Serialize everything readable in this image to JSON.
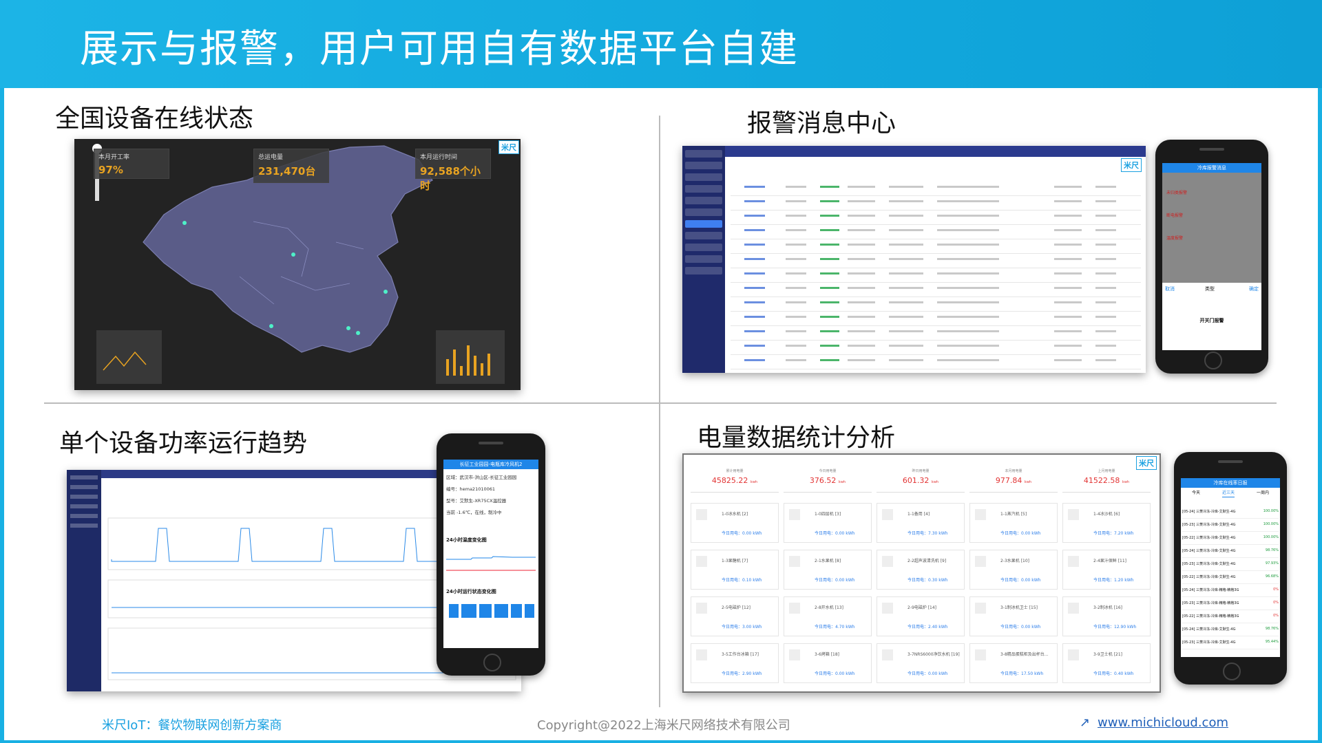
{
  "header": {
    "title": "展示与报警，用户可用自有数据平台自建"
  },
  "sections": {
    "online": "全国设备在线状态",
    "alarm": "报警消息中心",
    "power": "单个设备功率运行趋势",
    "energy": "电量数据统计分析"
  },
  "map_cards": [
    {
      "label": "本月开工率",
      "value": "97%"
    },
    {
      "label": "总运电量",
      "value": "231,470台"
    },
    {
      "label": "本月运行时间",
      "value": "92,588个小时"
    }
  ],
  "logo_text": "米尺",
  "phone_alarm": {
    "title": "冷库报警消息",
    "rows": [
      "未归类报警",
      "断电报警",
      "温度报警",
      "开关门报警"
    ],
    "picker_cancel": "取消",
    "picker_title": "类型",
    "picker_ok": "确定"
  },
  "phone_power": {
    "title": "长征工业园园-电瓶库冷风机2",
    "items": [
      "区域：武汉市-洪山区-长征工业园园",
      "编号：hema21010061",
      "型号：艾默生-XR75CX温控器",
      "当前 -1.6℃，在线，制冷中"
    ],
    "chart1": "24小时温度变化图",
    "chart2": "24小时运行状态变化图"
  },
  "energy": {
    "totals": [
      {
        "label": "累计用电量",
        "value": "45825.22",
        "unit": "kwh"
      },
      {
        "label": "今日用电量",
        "value": "376.52",
        "unit": "kwh"
      },
      {
        "label": "昨日用电量",
        "value": "601.32",
        "unit": "kwh"
      },
      {
        "label": "本月用电量",
        "value": "977.84",
        "unit": "kwh"
      },
      {
        "label": "上月用电量",
        "value": "41522.58",
        "unit": "kwh"
      }
    ],
    "devices": [
      {
        "name": "1-0冰水机 [2]",
        "val": "今日用电：0.00 kWh"
      },
      {
        "name": "1-0四层机 [3]",
        "val": "今日用电：0.00 kWh"
      },
      {
        "name": "1-1备用 [4]",
        "val": "今日用电：7.30 kWh"
      },
      {
        "name": "1-1蒸汽机 [5]",
        "val": "今日用电：0.00 kWh"
      },
      {
        "name": "1-4冰沙机 [6]",
        "val": "今日用电：7.20 kWh"
      },
      {
        "name": "1-3果糖机 [7]",
        "val": "今日用电：0.10 kWh"
      },
      {
        "name": "2-1水果机 [8]",
        "val": "今日用电：0.00 kWh"
      },
      {
        "name": "2-2超声波清洗机 [9]",
        "val": "今日用电：0.30 kWh"
      },
      {
        "name": "2-3水果机 [10]",
        "val": "今日用电：0.00 kWh"
      },
      {
        "name": "2-4果汁保鲜 [11]",
        "val": "今日用电：1.20 kWh"
      },
      {
        "name": "2-5电磁炉 [12]",
        "val": "今日用电：3.00 kWh"
      },
      {
        "name": "2-8开水机 [13]",
        "val": "今日用电：4.70 kWh"
      },
      {
        "name": "2-9电磁炉 [14]",
        "val": "今日用电：2.40 kWh"
      },
      {
        "name": "3-1制冰机卫士 [15]",
        "val": "今日用电：0.00 kWh"
      },
      {
        "name": "3-2制冰机 [16]",
        "val": "今日用电：12.90 kWh"
      },
      {
        "name": "3-5工作台冰箱 [17]",
        "val": "今日用电：2.90 kWh"
      },
      {
        "name": "3-6烤箱 [18]",
        "val": "今日用电：0.00 kWh"
      },
      {
        "name": "3-7NRS6000净饮水机 [19]",
        "val": "今日用电：0.00 kWh"
      },
      {
        "name": "3-8精品蛋糕柜及出杯台... ",
        "val": "今日用电：17.50 kWh"
      },
      {
        "name": "3-9卫士机 [21]",
        "val": "今日用电：0.40 kWh"
      }
    ]
  },
  "phone_energy": {
    "title": "冷库在线率日报",
    "tabs": [
      "今天",
      "近三天",
      "一周内"
    ],
    "rows": [
      {
        "n": "[05-24] 三菱冷冻-冷库-艾默生-4G",
        "p": "100.00%"
      },
      {
        "n": "[05-23] 三菱冷冻-冷库-艾默生-4G",
        "p": "100.00%"
      },
      {
        "n": "[05-22] 三菱冷冻-冷库-艾默生-4G",
        "p": "100.00%"
      },
      {
        "n": "[05-24] 三菱冷冻-冷库-艾默生-4G",
        "p": "98.76%"
      },
      {
        "n": "[05-23] 三菱冷冻-冷库-艾默生-4G",
        "p": "97.93%"
      },
      {
        "n": "[05-22] 三菱冷冻-冷库-艾默生-4G",
        "p": "96.68%"
      },
      {
        "n": "[05-24] 三菱冷冻-冷库-精格-精格3G",
        "p": "0%"
      },
      {
        "n": "[05-23] 三菱冷冻-冷库-精格-精格3G",
        "p": "0%"
      },
      {
        "n": "[05-22] 三菱冷冻-冷库-精格-精格3G",
        "p": "0%"
      },
      {
        "n": "[05-24] 三菱冷冻-冷库-艾默生-4G",
        "p": "98.76%"
      },
      {
        "n": "[05-23] 三菱冷冻-冷库-艾默生-4G",
        "p": "95.44%"
      }
    ]
  },
  "footer": {
    "left": "米尺IoT：餐饮物联网创新方案商",
    "center": "Copyright@2022上海米尺网络技术有限公司",
    "right": "www.michicloud.com",
    "arrow": "↗"
  },
  "colors": {
    "brand": "#19b0e3",
    "alarm_red": "#e23333",
    "link": "#1f5fb8"
  }
}
